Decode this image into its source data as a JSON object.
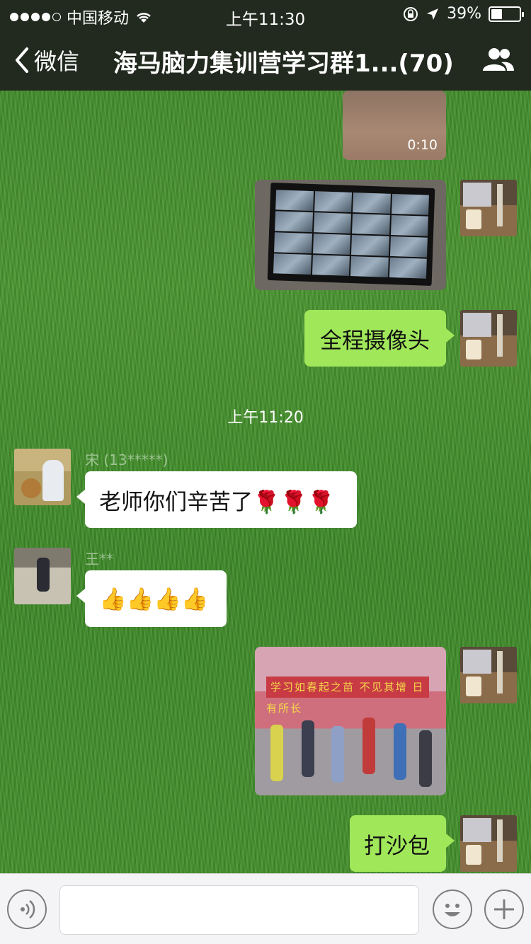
{
  "status_bar": {
    "carrier": "中国移动",
    "time": "上午11:30",
    "battery_percent": "39%",
    "battery_level": 0.39
  },
  "nav": {
    "back_label": "微信",
    "title": "海马脑力集训营学习群1...(70)"
  },
  "messages": {
    "video_duration": "0:10",
    "camera_text": "全程摄像头",
    "timestamp": "上午11:20",
    "sender1_name": "宋 (13*****)",
    "teacher_msg": "老师你们辛苦了🌹🌹🌹",
    "sender2_name": "王**",
    "thumbs_msg": "👍👍👍👍",
    "yard_banner": "学习如春起之苗 不见其增 日有所长",
    "sandbag_text": "打沙包"
  },
  "colors": {
    "my_bubble": "#a0e75a",
    "other_bubble": "#ffffff",
    "top_bar": "#222a1f"
  },
  "icons": [
    "signal-dots-icon",
    "wifi-icon",
    "lock-rotation-icon",
    "location-icon",
    "battery-icon",
    "back-chevron-icon",
    "group-members-icon",
    "voice-icon",
    "emoji-icon",
    "plus-icon"
  ]
}
